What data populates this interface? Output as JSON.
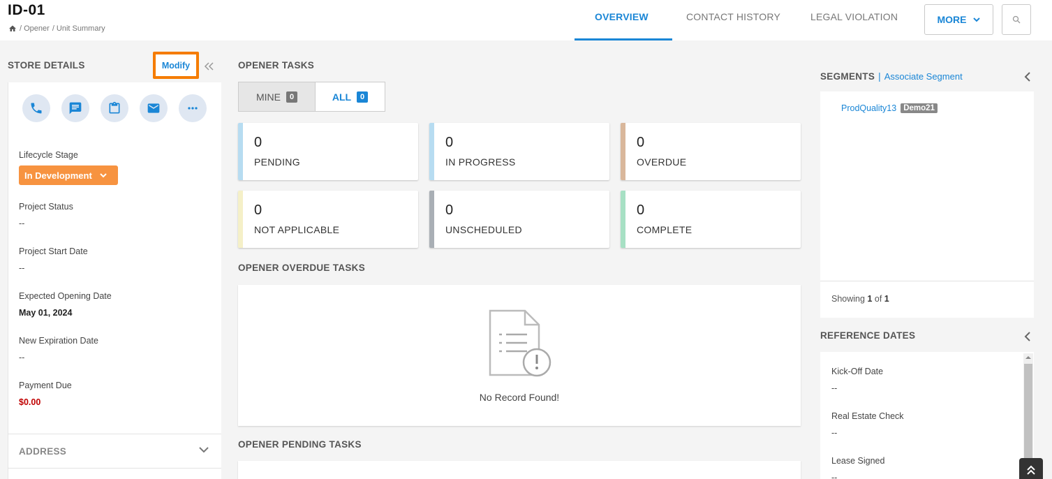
{
  "header": {
    "title": "ID-01",
    "breadcrumb": [
      "/ Opener",
      "/ Unit Summary"
    ],
    "tabs": [
      {
        "label": "OVERVIEW",
        "active": true
      },
      {
        "label": "CONTACT HISTORY"
      },
      {
        "label": "LEGAL VIOLATION"
      }
    ],
    "more_label": "MORE",
    "accent_color": "#1a86d6"
  },
  "store_details": {
    "title": "STORE DETAILS",
    "modify_label": "Modify",
    "actions": [
      "phone-icon",
      "chat-icon",
      "clipboard-icon",
      "mail-icon",
      "more-icon"
    ],
    "fields": {
      "lifecycle_label": "Lifecycle Stage",
      "lifecycle_value": "In Development",
      "project_status_label": "Project Status",
      "project_status_value": "--",
      "project_start_label": "Project Start Date",
      "project_start_value": "--",
      "expected_opening_label": "Expected Opening Date",
      "expected_opening_value": "May 01, 2024",
      "new_expiration_label": "New Expiration Date",
      "new_expiration_value": "--",
      "payment_due_label": "Payment Due",
      "payment_due_value": "$0.00"
    },
    "address_title": "ADDRESS"
  },
  "opener_tasks": {
    "title": "OPENER TASKS",
    "toggle": {
      "mine_label": "MINE",
      "mine_count": "0",
      "all_label": "ALL",
      "all_count": "0"
    },
    "stats": [
      {
        "value": "0",
        "label": "PENDING",
        "color": "#b7dcf1"
      },
      {
        "value": "0",
        "label": "IN PROGRESS",
        "color": "#b7dcf1"
      },
      {
        "value": "0",
        "label": "OVERDUE",
        "color": "#d9b79b"
      },
      {
        "value": "0",
        "label": "NOT APPLICABLE",
        "color": "#f5f0c8"
      },
      {
        "value": "0",
        "label": "UNSCHEDULED",
        "color": "#a9afb5"
      },
      {
        "value": "0",
        "label": "COMPLETE",
        "color": "#a7e0c4"
      }
    ]
  },
  "overdue_tasks": {
    "title": "OPENER OVERDUE TASKS",
    "empty_text": "No Record Found!"
  },
  "pending_tasks": {
    "title": "OPENER PENDING TASKS"
  },
  "segments": {
    "title": "SEGMENTS",
    "separator": "|",
    "associate_label": "Associate Segment",
    "item_name": "ProdQuality13",
    "item_badge": "Demo21",
    "showing_prefix": "Showing",
    "showing_current": "1",
    "showing_of": "of",
    "showing_total": "1"
  },
  "reference_dates": {
    "title": "REFERENCE DATES",
    "items": [
      {
        "label": "Kick-Off Date",
        "value": "--"
      },
      {
        "label": "Real Estate Check",
        "value": "--"
      },
      {
        "label": "Lease Signed",
        "value": "--"
      }
    ]
  }
}
